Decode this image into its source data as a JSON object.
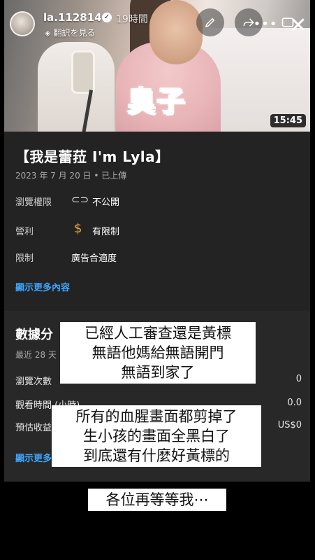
{
  "story": {
    "username": "la.112814",
    "time_ago": "19時間",
    "translate_label": "翻訳を見る",
    "more_glyph": "•••",
    "close_glyph": "✕"
  },
  "video": {
    "thumbnail_text": "臭子",
    "duration": "15:45",
    "title": "【我是蕾菈 I'm Lyla】",
    "upload_date": "2023 年 7 月 20 日 • 已上傳"
  },
  "details": {
    "rows": [
      {
        "label": "瀏覽權限",
        "icon": "link-icon",
        "value": "不公開"
      },
      {
        "label": "營利",
        "icon": "dollar-icon",
        "value": "有限制"
      },
      {
        "label": "限制",
        "icon": "",
        "value": "廣告合適度"
      }
    ],
    "show_more": "顯示更多內容"
  },
  "analytics": {
    "title": "數據分",
    "subtitle": "最近 28 天",
    "metrics": [
      {
        "label": "瀏覽次數",
        "value": "0"
      },
      {
        "label": "觀看時間 (小時)",
        "value": "0.0"
      },
      {
        "label": "預估收益",
        "value": "US$0"
      }
    ],
    "show_more": "顯示更多"
  },
  "captions": [
    {
      "lines": [
        "已經人工審查還是黃標",
        "無語他媽給無語開門",
        "無語到家了"
      ]
    },
    {
      "lines": [
        "所有的血腥畫面都剪掉了",
        "生小孩的畫面全黑白了",
        "到底還有什麼好黃標的"
      ]
    },
    {
      "lines": [
        "各位再等等我⋯"
      ]
    }
  ],
  "colors": {
    "accent_link": "#3ea6ff",
    "panel_bg": "#282828",
    "thumbnail_text": "#2f6fd6",
    "money_icon": "#e8a640"
  }
}
